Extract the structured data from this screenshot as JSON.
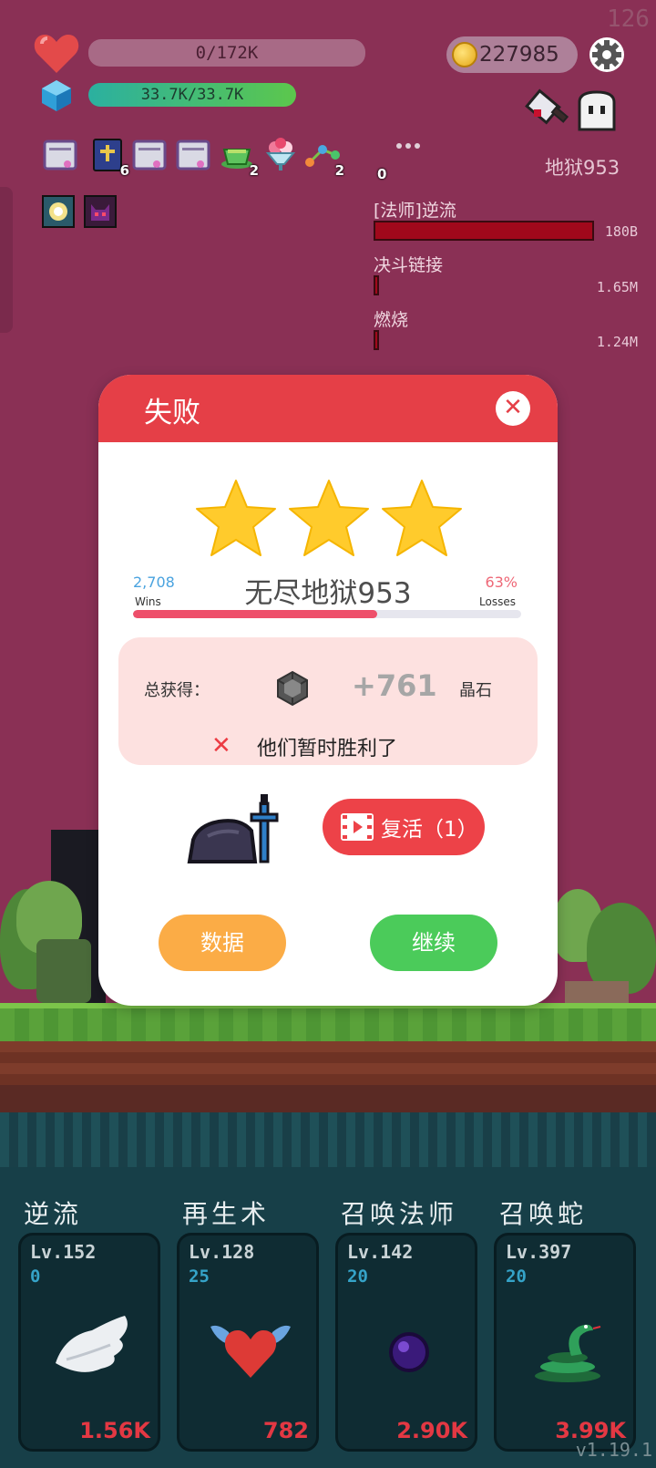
{
  "hud": {
    "fps": "126",
    "hp_text": "0/172K",
    "mana_text": "33.7K/33.7K",
    "gold": "227985",
    "hell_label": "地狱953"
  },
  "buffs": [
    {
      "icon": "scroll-icon",
      "count": ""
    },
    {
      "icon": "book-icon",
      "count": "6"
    },
    {
      "icon": "scroll-icon",
      "count": ""
    },
    {
      "icon": "scroll-icon",
      "count": ""
    },
    {
      "icon": "teacup-icon",
      "count": "2"
    },
    {
      "icon": "icecream-icon",
      "count": ""
    },
    {
      "icon": "molecule-icon",
      "count": "2"
    },
    {
      "icon": "more-dots-icon",
      "count": "0"
    }
  ],
  "enemy_effects": [
    {
      "label": "[法师]逆流",
      "value": "180B"
    },
    {
      "label": "决斗链接",
      "value": "1.65M"
    },
    {
      "label": "燃烧",
      "value": "1.24M"
    }
  ],
  "dialog": {
    "title": "失败",
    "close": "✕",
    "stars": 3,
    "wins": "2,708",
    "wins_label": "Wins",
    "losses_pct": "63%",
    "losses_label": "Losses",
    "level_name": "无尽地狱953",
    "progress_fraction": 0.63,
    "reward_label": "总获得：",
    "reward_amount": "+761",
    "reward_unit": "晶石",
    "fail_icon": "✕",
    "fail_message": "他们暂时胜利了",
    "revive_label": "复活（1）",
    "stats_label": "数据",
    "continue_label": "继续"
  },
  "skills": [
    {
      "name": "逆流",
      "level": "Lv.152",
      "cost": "0",
      "price": "1.56K",
      "icon": "wing-icon"
    },
    {
      "name": "再生术",
      "level": "Lv.128",
      "cost": "25",
      "price": "782",
      "icon": "winged-heart-icon"
    },
    {
      "name": "召唤法师",
      "level": "Lv.142",
      "cost": "20",
      "price": "2.90K",
      "icon": "purple-orb-icon"
    },
    {
      "name": "召唤蛇",
      "level": "Lv.397",
      "cost": "20",
      "price": "3.99K",
      "icon": "snake-icon"
    }
  ],
  "version": "v1.19.1",
  "colors": {
    "sky": "#8a3055",
    "dialog_header": "#e53f47",
    "revive": "#ed4248",
    "stats": "#fbac46",
    "continue": "#4bcb5a",
    "price": "#e33843"
  }
}
